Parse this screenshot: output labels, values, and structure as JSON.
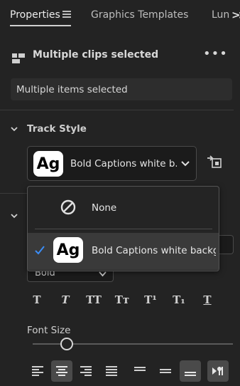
{
  "tabs": [
    {
      "label": "Properties",
      "active": true
    },
    {
      "label": "Graphics Templates",
      "active": false
    },
    {
      "label": "Lun",
      "active": false
    }
  ],
  "tab_menu_icon": "hamburger-menu-icon",
  "overflow_icon": "double-chevron-right-icon",
  "header": {
    "title": "Multiple clips selected",
    "more_icon": "ellipsis-icon"
  },
  "selection_field": {
    "value": "Multiple items selected"
  },
  "track_style": {
    "section_title": "Track Style",
    "selected_label": "Bold Captions white b...",
    "badge_text": "Ag",
    "push_icon": "push-to-track-icon"
  },
  "dropdown": {
    "options": [
      {
        "label": "None",
        "icon": "none-circle-slash-icon",
        "selected": false
      },
      {
        "label": "Bold Captions white backgr...",
        "badge_text": "Ag",
        "selected": true
      }
    ]
  },
  "text_section": {
    "font_style": "Bold",
    "type_buttons": [
      "T",
      "T",
      "TT",
      "Tт",
      "T¹",
      "T₁",
      "T"
    ],
    "font_size_label": "Font Size",
    "font_size_level": 0.17
  },
  "colors": {
    "background": "#232323",
    "field": "#2d2d2d",
    "select": "#1b1b1b",
    "highlight": "#3a3a3a",
    "check": "#3b8df7"
  }
}
